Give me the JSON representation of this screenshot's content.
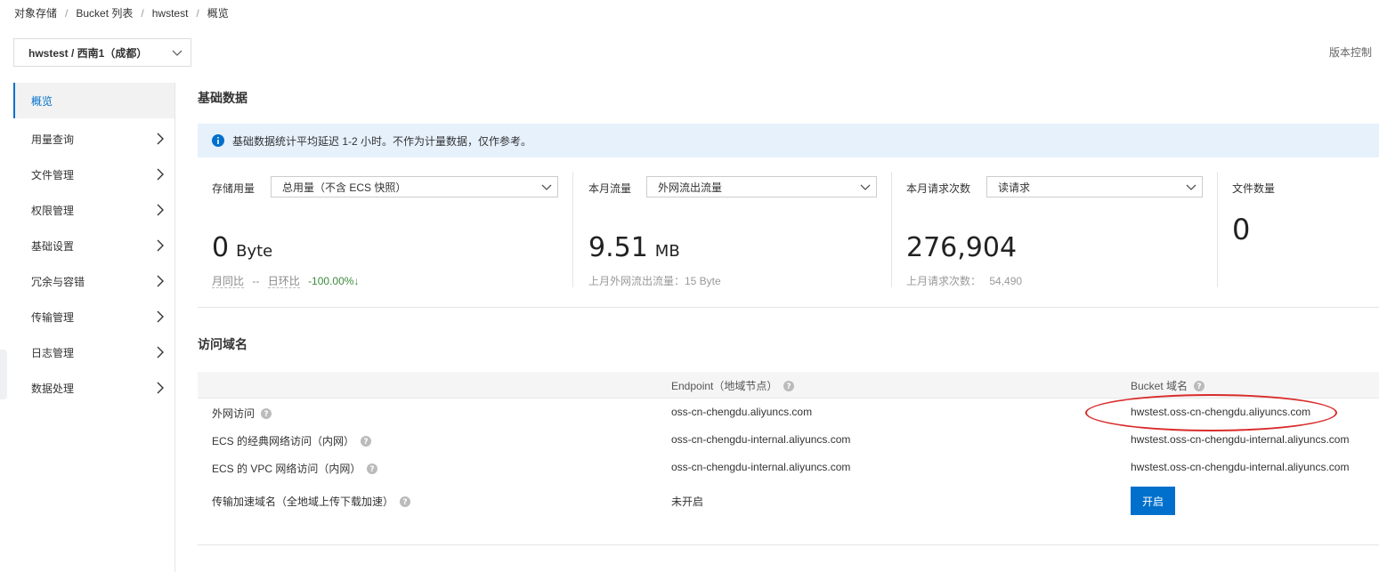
{
  "breadcrumb": [
    "对象存储",
    "Bucket 列表",
    "hwstest",
    "概览"
  ],
  "bucket_select": {
    "value": "hwstest / 西南1（成都）"
  },
  "version_link": "版本控制",
  "sidebar": {
    "items": [
      {
        "label": "概览",
        "active": true
      },
      {
        "label": "用量查询"
      },
      {
        "label": "文件管理"
      },
      {
        "label": "权限管理"
      },
      {
        "label": "基础设置"
      },
      {
        "label": "冗余与容错"
      },
      {
        "label": "传输管理"
      },
      {
        "label": "日志管理"
      },
      {
        "label": "数据处理"
      }
    ]
  },
  "basic": {
    "title": "基础数据",
    "notice": "基础数据统计平均延迟 1-2 小时。不作为计量数据，仅作参考。",
    "storage": {
      "label": "存储用量",
      "dropdown": "总用量（不含 ECS 快照）",
      "value": "0",
      "unit": "Byte",
      "yoy_label": "月同比",
      "yoy_value": "--",
      "dod_label": "日环比",
      "dod_value": "-100.00%",
      "dod_arrow": "↓"
    },
    "traffic": {
      "label": "本月流量",
      "dropdown": "外网流出流量",
      "value": "9.51",
      "unit": "MB",
      "sub": "上月外网流出流量：15 Byte"
    },
    "requests": {
      "label": "本月请求次数",
      "dropdown": "读请求",
      "value": "276,904",
      "sub_label": "上月请求次数：",
      "sub_value": "54,490"
    },
    "files": {
      "label": "文件数量",
      "value": "0"
    }
  },
  "domains": {
    "title": "访问域名",
    "headers": {
      "endpoint": "Endpoint（地域节点）",
      "bucket_domain": "Bucket 域名"
    },
    "rows": [
      {
        "name": "外网访问",
        "endpoint": "oss-cn-chengdu.aliyuncs.com",
        "bucket_domain": "hwstest.oss-cn-chengdu.aliyuncs.com"
      },
      {
        "name": "ECS 的经典网络访问（内网）",
        "endpoint": "oss-cn-chengdu-internal.aliyuncs.com",
        "bucket_domain": "hwstest.oss-cn-chengdu-internal.aliyuncs.com"
      },
      {
        "name": "ECS 的 VPC 网络访问（内网）",
        "endpoint": "oss-cn-chengdu-internal.aliyuncs.com",
        "bucket_domain": "hwstest.oss-cn-chengdu-internal.aliyuncs.com"
      }
    ],
    "accel": {
      "name": "传输加速域名（全地域上传下载加速）",
      "status": "未开启",
      "button": "开启"
    }
  },
  "colors": {
    "accent": "#0070cc",
    "notice_bg": "#e6f1fc",
    "positive": "#3c8a3c",
    "highlight": "#d92c2c"
  }
}
